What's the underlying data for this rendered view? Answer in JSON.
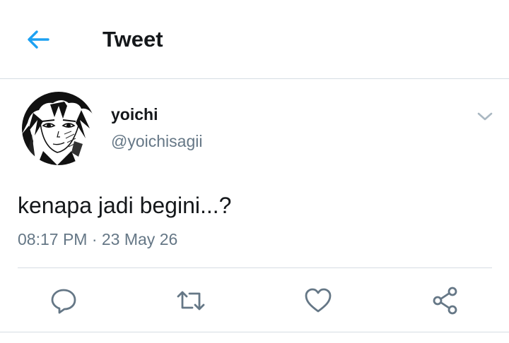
{
  "header": {
    "title": "Tweet",
    "back_icon": "arrow-left-icon",
    "accent_color": "#1da1f2"
  },
  "tweet": {
    "author": {
      "display_name": "yoichi",
      "handle": "@yoichisagii",
      "avatar_icon": "manga-character-avatar"
    },
    "text": "kenapa jadi begini...?",
    "timestamp": "08:17 PM · 23 May 26",
    "menu_icon": "chevron-down-icon"
  },
  "actions": [
    {
      "name": "reply",
      "icon": "speech-bubble-icon"
    },
    {
      "name": "retweet",
      "icon": "retweet-icon"
    },
    {
      "name": "like",
      "icon": "heart-icon"
    },
    {
      "name": "share",
      "icon": "share-icon"
    }
  ],
  "colors": {
    "primary_text": "#14171a",
    "secondary_text": "#657786",
    "divider": "#d6dde3",
    "icon_gray": "#657786"
  }
}
